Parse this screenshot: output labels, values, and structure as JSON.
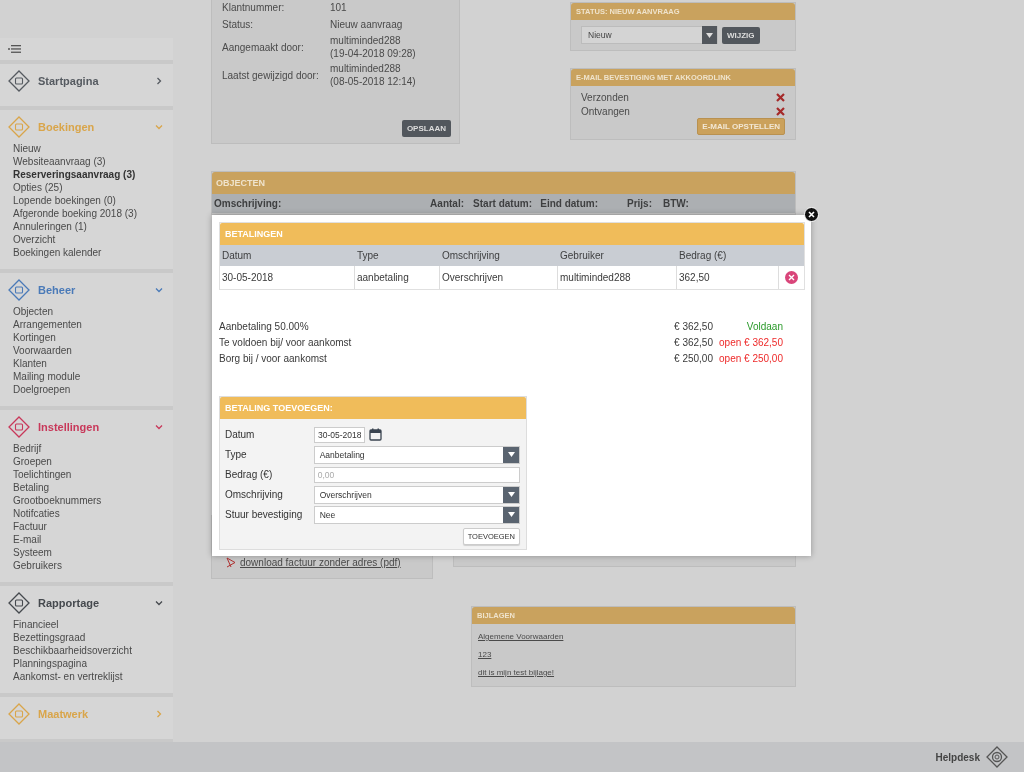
{
  "sidebar": {
    "sections": [
      {
        "title": "Startpagina",
        "color": "#555a60",
        "expanded": false
      },
      {
        "title": "Boekingen",
        "color": "#d9a54a",
        "expanded": true,
        "items": [
          {
            "label": "Nieuw",
            "selected": false
          },
          {
            "label": "Websiteaanvraag (3)",
            "selected": false
          },
          {
            "label": "Reserveringsaanvraag (3)",
            "selected": true
          },
          {
            "label": "Opties (25)",
            "selected": false
          },
          {
            "label": "Lopende boekingen (0)",
            "selected": false
          },
          {
            "label": "Afgeronde boeking 2018 (3)",
            "selected": false
          },
          {
            "label": "Annuleringen (1)",
            "selected": false
          },
          {
            "label": "Overzicht",
            "selected": false
          },
          {
            "label": "Boekingen kalender",
            "selected": false
          }
        ]
      },
      {
        "title": "Beheer",
        "color": "#4a7ab8",
        "expanded": true,
        "items": [
          {
            "label": "Objecten",
            "selected": false
          },
          {
            "label": "Arrangementen",
            "selected": false
          },
          {
            "label": "Kortingen",
            "selected": false
          },
          {
            "label": "Voorwaarden",
            "selected": false
          },
          {
            "label": "Klanten",
            "selected": false
          },
          {
            "label": "Mailing module",
            "selected": false
          },
          {
            "label": "Doelgroepen",
            "selected": false
          }
        ]
      },
      {
        "title": "Instellingen",
        "color": "#c8385a",
        "expanded": true,
        "items": [
          {
            "label": "Bedrijf",
            "selected": false
          },
          {
            "label": "Groepen",
            "selected": false
          },
          {
            "label": "Toelichtingen",
            "selected": false
          },
          {
            "label": "Betaling",
            "selected": false
          },
          {
            "label": "Grootboeknummers",
            "selected": false
          },
          {
            "label": "Notifcaties",
            "selected": false
          },
          {
            "label": "Factuur",
            "selected": false
          },
          {
            "label": "E-mail",
            "selected": false
          },
          {
            "label": "Systeem",
            "selected": false
          },
          {
            "label": "Gebruikers",
            "selected": false
          }
        ]
      },
      {
        "title": "Rapportage",
        "color": "#45494e",
        "expanded": true,
        "items": [
          {
            "label": "Financieel",
            "selected": false
          },
          {
            "label": "Bezettingsgraad",
            "selected": false
          },
          {
            "label": "Beschikbaarheidsoverzicht",
            "selected": false
          },
          {
            "label": "Planningspagina",
            "selected": false
          },
          {
            "label": "Aankomst- en vertreklijst",
            "selected": false
          }
        ]
      },
      {
        "title": "Maatwerk",
        "color": "#d9a54a",
        "expanded": false
      }
    ]
  },
  "customer": {
    "rows": [
      {
        "label": "Klantnummer:",
        "lines": [
          "101"
        ]
      },
      {
        "label": "Status:",
        "lines": [
          "Nieuw aanvraag"
        ]
      },
      {
        "label": "Aangemaakt door:",
        "lines": [
          "multiminded288",
          "(19-04-2018 09:28)"
        ]
      },
      {
        "label": "Laatst gewijzigd door:",
        "lines": [
          "multiminded288",
          "(08-05-2018 12:14)"
        ]
      }
    ],
    "button": "OPSLAAN"
  },
  "status_panel": {
    "title": "STATUS: NIEUW AANVRAAG",
    "select": "Nieuw",
    "button": "WIJZIG"
  },
  "email_panel": {
    "title": "E-MAIL BEVESTIGING MET AKKOORDLINK",
    "rows": [
      {
        "label": "Verzonden",
        "done": false
      },
      {
        "label": "Ontvangen",
        "done": false
      }
    ],
    "button": "E-MAIL OPSTELLEN"
  },
  "objecten": {
    "title": "OBJECTEN",
    "columns": [
      "Omschrijving:",
      "Aantal:",
      "Start datum:",
      "Eind datum:",
      "Prijs:",
      "BTW:"
    ]
  },
  "invoice_link": "download factuur zonder adres (pdf)",
  "bijlagen": {
    "title": "BIJLAGEN",
    "links": [
      "Algemene Voorwaarden",
      "123",
      "dit is mijn test bijlage!"
    ]
  },
  "footer": {
    "helpdesk": "Helpdesk"
  },
  "modal": {
    "payments": {
      "title": "BETALINGEN",
      "columns": [
        "Datum",
        "Type",
        "Omschrijving",
        "Gebruiker",
        "Bedrag (€)"
      ],
      "rows": [
        {
          "cells": [
            "30-05-2018",
            "aanbetaling",
            "Overschrijven",
            "multiminded288",
            "362,50"
          ]
        }
      ],
      "summary": [
        {
          "label": "Aanbetaling 50.00%",
          "amount": "€ 362,50",
          "status": "Voldaan",
          "paid": true
        },
        {
          "label": "Te voldoen bij/ voor aankomst",
          "amount": "€ 362,50",
          "status": "open € 362,50",
          "paid": false
        },
        {
          "label": "Borg bij / voor aankomst",
          "amount": "€ 250,00",
          "status": "open € 250,00",
          "paid": false
        }
      ]
    },
    "add_form": {
      "title": "BETALING TOEVOEGEN:",
      "fields": [
        {
          "label": "Datum",
          "kind": "date",
          "value": "30-05-2018"
        },
        {
          "label": "Type",
          "kind": "select",
          "value": "Aanbetaling"
        },
        {
          "label": "Bedrag (€)",
          "kind": "text",
          "placeholder": "0,00"
        },
        {
          "label": "Omschrijving",
          "kind": "select",
          "value": "Overschrijven"
        },
        {
          "label": "Stuur bevestiging",
          "kind": "select",
          "value": "Nee"
        }
      ],
      "button": "TOEVOEGEN"
    }
  }
}
